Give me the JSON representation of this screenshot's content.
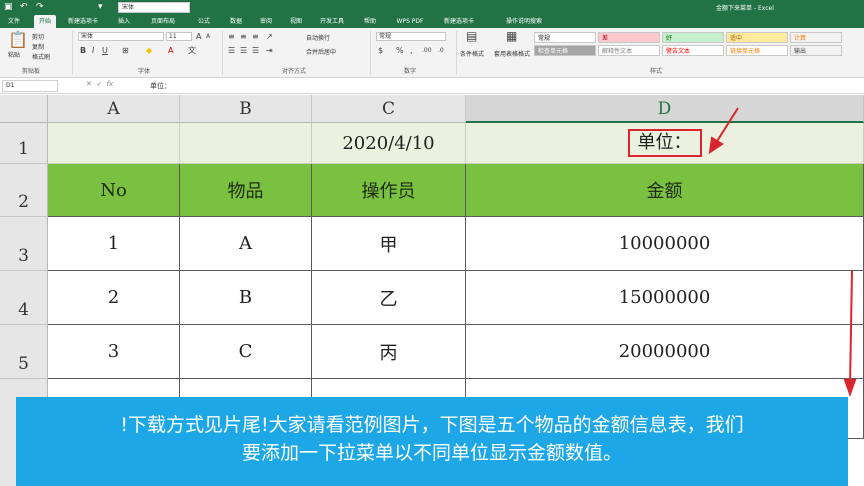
{
  "window": {
    "title": "金额下来菜单 - Excel"
  },
  "quick_access": {
    "font_box": "宋体"
  },
  "tabs": [
    "文件",
    "开始",
    "新建选项卡",
    "插入",
    "页面布局",
    "公式",
    "数据",
    "审阅",
    "视图",
    "开发工具",
    "帮助",
    "WPS PDF",
    "新建选项卡",
    "操作说明搜索"
  ],
  "active_tab_index": 1,
  "ribbon": {
    "clipboard": {
      "paste": "粘贴",
      "cut": "剪切",
      "copy": "复制",
      "painter": "格式刷",
      "label": "剪贴板"
    },
    "font": {
      "name": "宋体",
      "size": "11",
      "label": "字体"
    },
    "alignment": {
      "wrap": "自动换行",
      "merge": "合并后居中",
      "label": "对齐方式"
    },
    "number": {
      "format": "常规",
      "label": "数字"
    },
    "styles": {
      "conditional": "条件格式",
      "table": "套用表格格式",
      "label": "样式",
      "cells": [
        {
          "text": "常规",
          "bg": "#ffffff",
          "fg": "#222222"
        },
        {
          "text": "差",
          "bg": "#ffc7ce",
          "fg": "#9c0006"
        },
        {
          "text": "好",
          "bg": "#c6efce",
          "fg": "#006100"
        },
        {
          "text": "适中",
          "bg": "#ffeb9c",
          "fg": "#9c5700"
        },
        {
          "text": "计算",
          "bg": "#f2f2f2",
          "fg": "#fa7d00"
        },
        {
          "text": "检查单元格",
          "bg": "#a5a5a5",
          "fg": "#ffffff"
        },
        {
          "text": "解释性文本",
          "bg": "#ffffff",
          "fg": "#7f7f7f"
        },
        {
          "text": "警告文本",
          "bg": "#ffffff",
          "fg": "#ff0000"
        },
        {
          "text": "链接单元格",
          "bg": "#ffffff",
          "fg": "#fa7d00"
        },
        {
          "text": "输出",
          "bg": "#f2f2f2",
          "fg": "#3f3f3f"
        }
      ]
    }
  },
  "formula_bar": {
    "name_box": "D1",
    "value": "单位："
  },
  "columns": [
    "A",
    "B",
    "C",
    "D"
  ],
  "rows": [
    "1",
    "2",
    "3",
    "4",
    "5"
  ],
  "sheet": {
    "row1": {
      "date": "2020/4/10",
      "unit": "单位："
    },
    "headers": [
      "No",
      "物品",
      "操作员",
      "金额"
    ],
    "data": [
      [
        "1",
        "A",
        "甲",
        "10000000"
      ],
      [
        "2",
        "B",
        "乙",
        "15000000"
      ],
      [
        "3",
        "C",
        "丙",
        "20000000"
      ]
    ]
  },
  "banner": {
    "line1": "!下载方式见片尾!大家请看范例图片，下图是五个物品的金额信息表，我们",
    "line2": "要添加一下拉菜单以不同单位显示金额数值。"
  },
  "colors": {
    "excel_green": "#217346",
    "header_row": "#7ac142",
    "title_row": "#ebf1de",
    "annotation_red": "#d9262e",
    "banner": "#1ea7e6"
  }
}
